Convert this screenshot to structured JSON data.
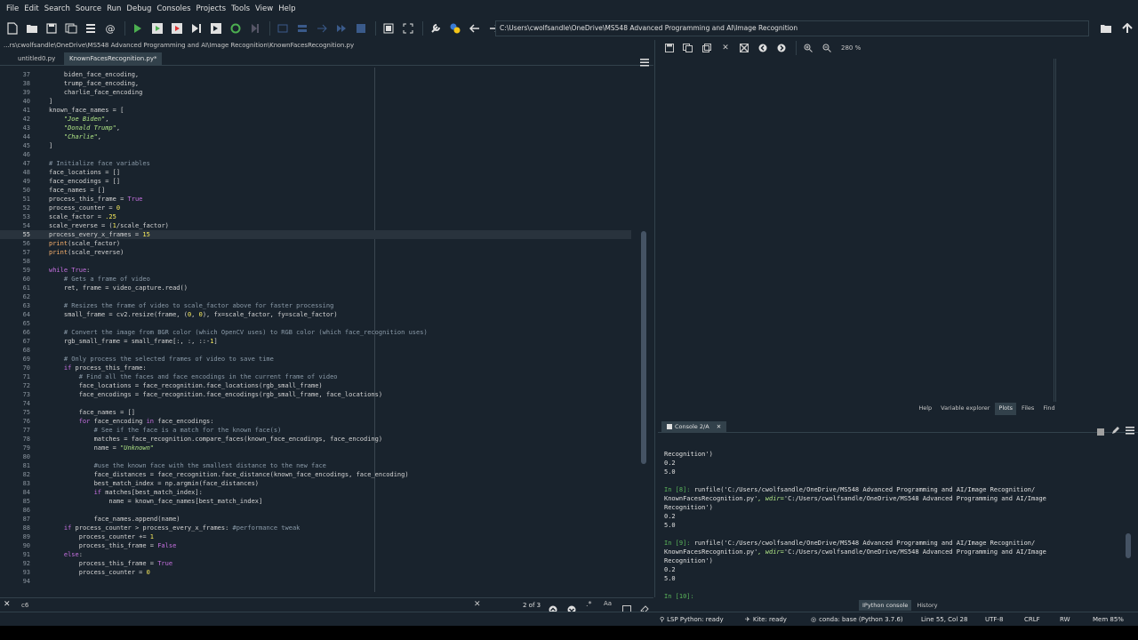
{
  "menu": [
    "File",
    "Edit",
    "Search",
    "Source",
    "Run",
    "Debug",
    "Consoles",
    "Projects",
    "Tools",
    "View",
    "Help"
  ],
  "toolbar": {
    "path": "C:\\Users\\cwolfsandle\\OneDrive\\MS548 Advanced Programming and AI\\Image Recognition"
  },
  "editor": {
    "file_path": "...rs\\cwolfsandle\\OneDrive\\MS548 Advanced Programming and AI\\Image Recognition\\KnownFacesRecognition.py",
    "tabs": [
      {
        "label": "untitled0.py"
      },
      {
        "label": "KnownFacesRecognition.py*"
      }
    ],
    "lines": [
      {
        "n": "37",
        "t": "    biden_face_encoding,"
      },
      {
        "n": "38",
        "t": "    trump_face_encoding,"
      },
      {
        "n": "39",
        "t": "    charlie_face_encoding"
      },
      {
        "n": "40",
        "t": "]"
      },
      {
        "n": "41",
        "t": "known_face_names = ["
      },
      {
        "n": "42",
        "t": "    \"Joe Biden\","
      },
      {
        "n": "43",
        "t": "    \"Donald Trump\","
      },
      {
        "n": "44",
        "t": "    \"Charlie\","
      },
      {
        "n": "45",
        "t": "]"
      },
      {
        "n": "46",
        "t": ""
      },
      {
        "n": "47",
        "t": "# Initialize face variables"
      },
      {
        "n": "48",
        "t": "face_locations = []"
      },
      {
        "n": "49",
        "t": "face_encodings = []"
      },
      {
        "n": "50",
        "t": "face_names = []"
      },
      {
        "n": "51",
        "t": "process_this_frame = True"
      },
      {
        "n": "52",
        "t": "process_counter = 0"
      },
      {
        "n": "53",
        "t": "scale_factor = .25"
      },
      {
        "n": "54",
        "t": "scale_reverse = (1/scale_factor)"
      },
      {
        "n": "55",
        "t": "process_every_x_frames = 15"
      },
      {
        "n": "56",
        "t": "print(scale_factor)"
      },
      {
        "n": "57",
        "t": "print(scale_reverse)"
      },
      {
        "n": "58",
        "t": ""
      },
      {
        "n": "59",
        "t": "while True:"
      },
      {
        "n": "60",
        "t": "    # Gets a frame of video"
      },
      {
        "n": "61",
        "t": "    ret, frame = video_capture.read()"
      },
      {
        "n": "62",
        "t": ""
      },
      {
        "n": "63",
        "t": "    # Resizes the frame of video to scale_factor above for faster processing"
      },
      {
        "n": "64",
        "t": "    small_frame = cv2.resize(frame, (0, 0), fx=scale_factor, fy=scale_factor)"
      },
      {
        "n": "65",
        "t": ""
      },
      {
        "n": "66",
        "t": "    # Convert the image from BGR color (which OpenCV uses) to RGB color (which face_recognition uses)"
      },
      {
        "n": "67",
        "t": "    rgb_small_frame = small_frame[:, :, ::-1]"
      },
      {
        "n": "68",
        "t": ""
      },
      {
        "n": "69",
        "t": "    # Only process the selected frames of video to save time"
      },
      {
        "n": "70",
        "t": "    if process_this_frame:"
      },
      {
        "n": "71",
        "t": "        # Find all the faces and face encodings in the current frame of video"
      },
      {
        "n": "72",
        "t": "        face_locations = face_recognition.face_locations(rgb_small_frame)"
      },
      {
        "n": "73",
        "t": "        face_encodings = face_recognition.face_encodings(rgb_small_frame, face_locations)"
      },
      {
        "n": "74",
        "t": ""
      },
      {
        "n": "75",
        "t": "        face_names = []"
      },
      {
        "n": "76",
        "t": "        for face_encoding in face_encodings:"
      },
      {
        "n": "77",
        "t": "            # See if the face is a match for the known face(s)"
      },
      {
        "n": "78",
        "t": "            matches = face_recognition.compare_faces(known_face_encodings, face_encoding)"
      },
      {
        "n": "79",
        "t": "            name = \"Unknown\""
      },
      {
        "n": "80",
        "t": ""
      },
      {
        "n": "81",
        "t": "            #use the known face with the smallest distance to the new face"
      },
      {
        "n": "82",
        "t": "            face_distances = face_recognition.face_distance(known_face_encodings, face_encoding)"
      },
      {
        "n": "83",
        "t": "            best_match_index = np.argmin(face_distances)"
      },
      {
        "n": "84",
        "t": "            if matches[best_match_index]:"
      },
      {
        "n": "85",
        "t": "                name = known_face_names[best_match_index]"
      },
      {
        "n": "86",
        "t": ""
      },
      {
        "n": "87",
        "t": "            face_names.append(name)"
      },
      {
        "n": "88",
        "t": "    if process_counter > process_every_x_frames: #performance tweak"
      },
      {
        "n": "89",
        "t": "        process_counter += 1"
      },
      {
        "n": "90",
        "t": "        process_this_frame = False"
      },
      {
        "n": "91",
        "t": "    else:"
      },
      {
        "n": "92",
        "t": "        process_this_frame = True"
      },
      {
        "n": "93",
        "t": "        process_counter = 0"
      },
      {
        "n": "94",
        "t": ""
      }
    ],
    "current_line": "55"
  },
  "find": {
    "query": "c6",
    "count": "2 of 3"
  },
  "plots": {
    "zoom": "280 %"
  },
  "pane_tabs": [
    {
      "label": "Help",
      "active": false
    },
    {
      "label": "Variable explorer",
      "active": false
    },
    {
      "label": "Plots",
      "active": true
    },
    {
      "label": "Files",
      "active": false
    },
    {
      "label": "Find",
      "active": false
    }
  ],
  "console": {
    "tab_label": "Console 2/A",
    "lines": [
      {
        "kind": "out",
        "t": "Recognition')"
      },
      {
        "kind": "out",
        "t": "0.2"
      },
      {
        "kind": "out",
        "t": "5.0"
      },
      {
        "kind": "out",
        "t": ""
      },
      {
        "kind": "in",
        "p": "In [8]: ",
        "t": "runfile('C:/Users/cwolfsandle/OneDrive/MS548 Advanced Programming and AI/Image Recognition/"
      },
      {
        "kind": "cont",
        "t": "KnownFacesRecognition.py', wdir='C:/Users/cwolfsandle/OneDrive/MS548 Advanced Programming and AI/Image"
      },
      {
        "kind": "cont",
        "t": "Recognition')"
      },
      {
        "kind": "out",
        "t": "0.2"
      },
      {
        "kind": "out",
        "t": "5.0"
      },
      {
        "kind": "out",
        "t": ""
      },
      {
        "kind": "in",
        "p": "In [9]: ",
        "t": "runfile('C:/Users/cwolfsandle/OneDrive/MS548 Advanced Programming and AI/Image Recognition/"
      },
      {
        "kind": "cont",
        "t": "KnownFacesRecognition.py', wdir='C:/Users/cwolfsandle/OneDrive/MS548 Advanced Programming and AI/Image"
      },
      {
        "kind": "cont",
        "t": "Recognition')"
      },
      {
        "kind": "out",
        "t": "0.2"
      },
      {
        "kind": "out",
        "t": "5.0"
      },
      {
        "kind": "out",
        "t": ""
      },
      {
        "kind": "in",
        "p": "In [10]: ",
        "t": ""
      }
    ],
    "bottom_tabs": [
      {
        "label": "IPython console",
        "active": true
      },
      {
        "label": "History",
        "active": false
      }
    ]
  },
  "status": {
    "lsp": "LSP Python: ready",
    "kite": "Kite: ready",
    "conda": "conda: base (Python 3.7.6)",
    "position": "Line 55, Col 28",
    "encoding": "UTF-8",
    "eol": "CRLF",
    "rw": "RW",
    "mem": "Mem 85%"
  },
  "colors": {
    "background": "#19232d",
    "accent": "#32414b"
  }
}
